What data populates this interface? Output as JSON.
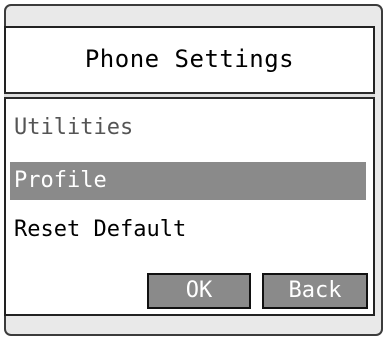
{
  "header": {
    "title": "Phone Settings"
  },
  "menu": {
    "items": [
      {
        "label": "Utilities",
        "state": "dimmed"
      },
      {
        "label": "Profile",
        "state": "selected"
      },
      {
        "label": "Reset Default",
        "state": "normal"
      }
    ]
  },
  "buttons": {
    "ok_label": "OK",
    "back_label": "Back"
  },
  "colors": {
    "selection": "#8a8a8a",
    "button": "#8a8a8a",
    "frame": "#e9e9e9",
    "panel": "#ffffff"
  }
}
